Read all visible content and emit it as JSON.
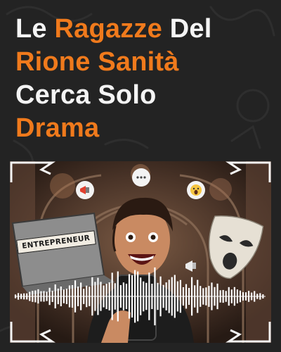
{
  "headline": {
    "line1_white": "Le ",
    "line1_orange": "Ragazze",
    "line1_white_end": " Del",
    "line2_orange": "Rione Sanità",
    "line3_white": "Cerca Solo",
    "line4_orange": "Drama"
  },
  "hero": {
    "laptop_sticker": "ENTREPRENEUR",
    "icons": [
      "megaphone-icon",
      "speech-bubble-icon",
      "screaming-face-icon",
      "megaphone-icon",
      "tragedy-mask-icon",
      "smartphone-icon",
      "audio-waveform-icon"
    ]
  },
  "colors": {
    "background": "#232323",
    "accent": "#f07a1c",
    "text": "#f4f4f4"
  }
}
